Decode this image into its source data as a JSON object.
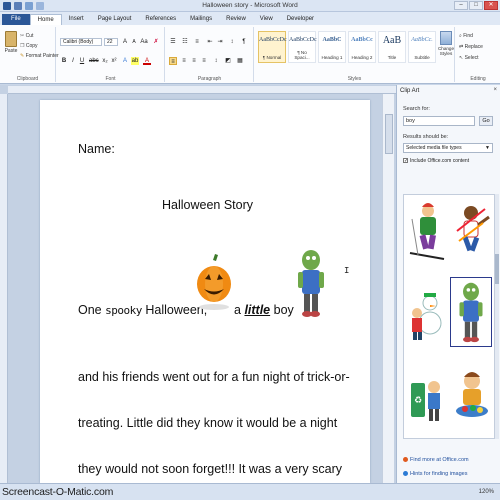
{
  "window": {
    "title": "Halloween story  -  Microsoft Word",
    "minimize": "–",
    "maximize": "□",
    "close": "✕"
  },
  "tabs": [
    "File",
    "Home",
    "Insert",
    "Page Layout",
    "References",
    "Mailings",
    "Review",
    "View",
    "Developer"
  ],
  "ribbon": {
    "clipboard": {
      "paste": "Paste",
      "cut": "Cut",
      "copy": "Copy",
      "format_painter": "Format Painter",
      "label": "Clipboard"
    },
    "font": {
      "family": "Calibri (Body)",
      "size": "22",
      "bold": "B",
      "italic": "I",
      "underline": "U",
      "label": "Font"
    },
    "paragraph": {
      "label": "Paragraph"
    },
    "styles": {
      "label": "Styles",
      "items": [
        {
          "preview": "AaBbCcDc",
          "name": "¶ Normal"
        },
        {
          "preview": "AaBbCcDc",
          "name": "¶ No Spaci..."
        },
        {
          "preview": "AaBbC",
          "name": "Heading 1"
        },
        {
          "preview": "AaBbCc",
          "name": "Heading 2"
        },
        {
          "preview": "AaB",
          "name": "Title"
        },
        {
          "preview": "AaBbCc.",
          "name": "Subtitle"
        }
      ],
      "change_styles": "Change Styles"
    },
    "editing": {
      "find": "Find",
      "replace": "Replace",
      "select": "Select",
      "label": "Editing"
    }
  },
  "document": {
    "lines": {
      "name": "Name:",
      "title": "Halloween Story",
      "l1_a": "One",
      "l1_spooky": "spooky",
      "l1_b": "Halloween,",
      "l1_a2": "a",
      "l1_little": "little",
      "l1_boy": "boy",
      "l2": "and his friends went out for a fun night of trick-or-",
      "l3": "treating.  Little did they know it would be a night",
      "l4": "they would not soon forget!!!  It was a very scary"
    }
  },
  "clip_art": {
    "title": "Clip Art",
    "close": "×",
    "search_label": "Search for:",
    "search_value": "boy",
    "go": "Go",
    "results_label": "Results should be:",
    "results_value": "Selected media file types",
    "include_label": "Include Office.com content",
    "include_checked": "✓",
    "link_more": "Find more at Office.com",
    "link_hints": "Hints for finding images"
  },
  "status": {
    "watermark": "Screencast-O-Matic.com",
    "zoom": "120%"
  }
}
